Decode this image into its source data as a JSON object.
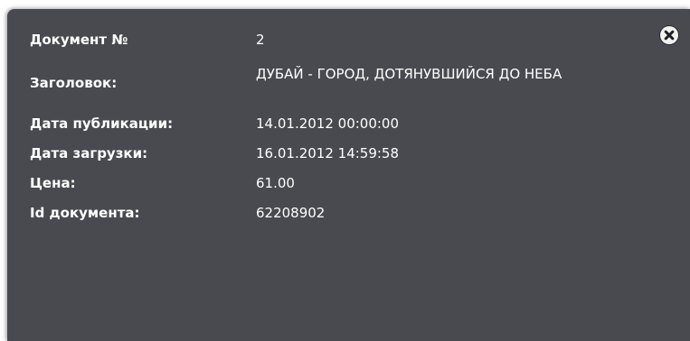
{
  "dialog": {
    "close_icon": "close-circle-icon",
    "background": "#484a4f",
    "fields": [
      {
        "label": "Документ №",
        "value": "2"
      },
      {
        "label": "Заголовок:",
        "value": "ДУБАЙ - ГОРОД, ДОТЯНУВШИЙСЯ ДО НЕБА"
      },
      {
        "label": "Дата публикации:",
        "value": "14.01.2012 00:00:00"
      },
      {
        "label": "Дата загрузки:",
        "value": "16.01.2012 14:59:58"
      },
      {
        "label": "Цена:",
        "value": "61.00"
      },
      {
        "label": "Id документа:",
        "value": "62208902"
      }
    ]
  }
}
